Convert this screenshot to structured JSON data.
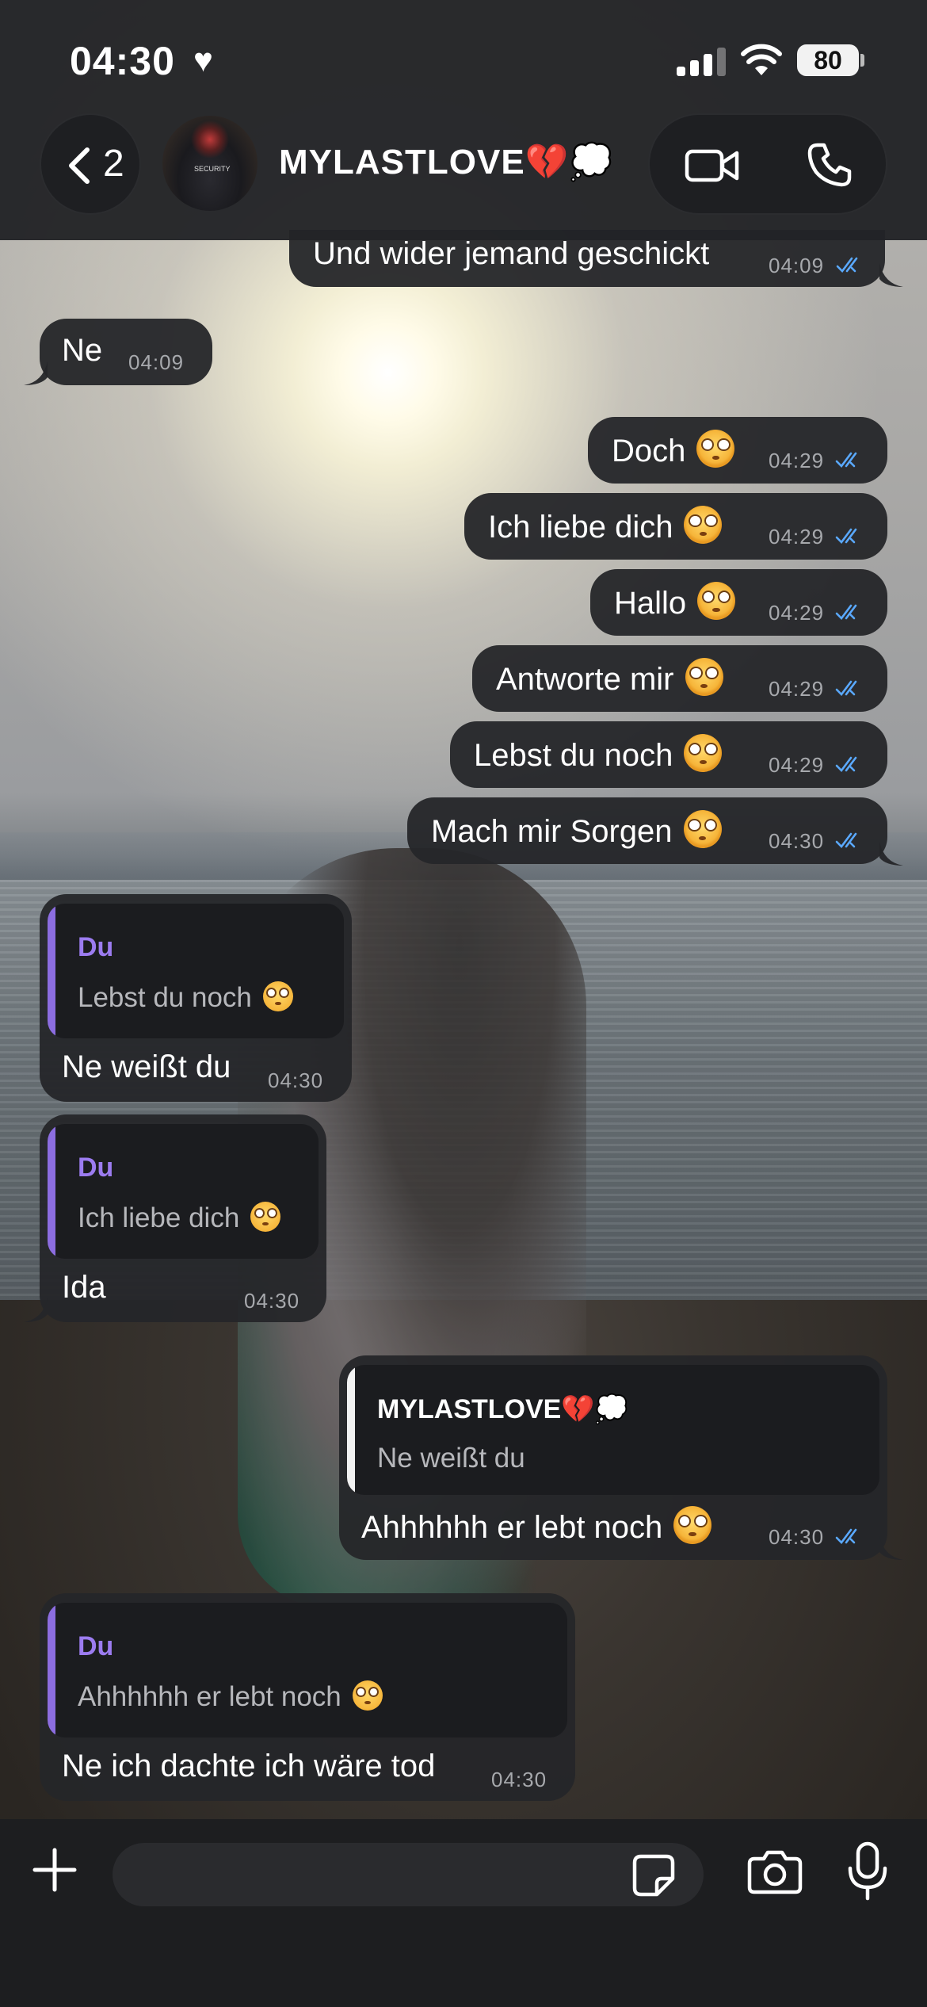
{
  "status": {
    "time": "04:30",
    "heart": "♥",
    "battery": "80"
  },
  "header": {
    "back_count": "2",
    "chat_name": "MYLASTLOVE💔💭",
    "avatar_label": "SECURITY"
  },
  "messages": [
    {
      "dir": "out",
      "text": "Und wider jemand geschickt",
      "time": "04:09",
      "emoji": false
    },
    {
      "dir": "in",
      "text": "Ne",
      "time": "04:09",
      "emoji": false
    },
    {
      "dir": "out",
      "text": "Doch",
      "time": "04:29",
      "emoji": true
    },
    {
      "dir": "out",
      "text": "Ich liebe dich",
      "time": "04:29",
      "emoji": true
    },
    {
      "dir": "out",
      "text": "Hallo",
      "time": "04:29",
      "emoji": true
    },
    {
      "dir": "out",
      "text": "Antworte mir",
      "time": "04:29",
      "emoji": true
    },
    {
      "dir": "out",
      "text": "Lebst du noch",
      "time": "04:29",
      "emoji": true
    },
    {
      "dir": "out",
      "text": "Mach mir Sorgen",
      "time": "04:30",
      "emoji": true
    },
    {
      "dir": "in",
      "text": "Ne weißt du",
      "time": "04:30",
      "reply": {
        "author": "Du",
        "text": "Lebst du noch",
        "emoji": true
      }
    },
    {
      "dir": "in",
      "text": "Ida",
      "time": "04:30",
      "reply": {
        "author": "Du",
        "text": "Ich liebe dich",
        "emoji": true
      }
    },
    {
      "dir": "out",
      "text": "Ahhhhhh er lebt noch",
      "time": "04:30",
      "emoji": true,
      "reply": {
        "author": "MYLASTLOVE💔💭",
        "text": "Ne weißt du",
        "emoji": false
      }
    },
    {
      "dir": "in",
      "text": "Ne ich dachte ich wäre tod",
      "time": "04:30",
      "reply": {
        "author": "Du",
        "text": "Ahhhhhh er lebt noch",
        "emoji": true
      }
    }
  ],
  "icons": {
    "back": "chevron-left-icon",
    "video": "video-camera-icon",
    "phone": "phone-icon",
    "plus": "plus-icon",
    "sticker": "sticker-icon",
    "camera": "camera-icon",
    "mic": "microphone-icon",
    "read": "double-check-icon",
    "emoji": "flushed-face-emoji"
  },
  "colors": {
    "reply_author": "#9c7cf0",
    "read_ticks": "#5aa9ff",
    "bubble": "#252629"
  }
}
